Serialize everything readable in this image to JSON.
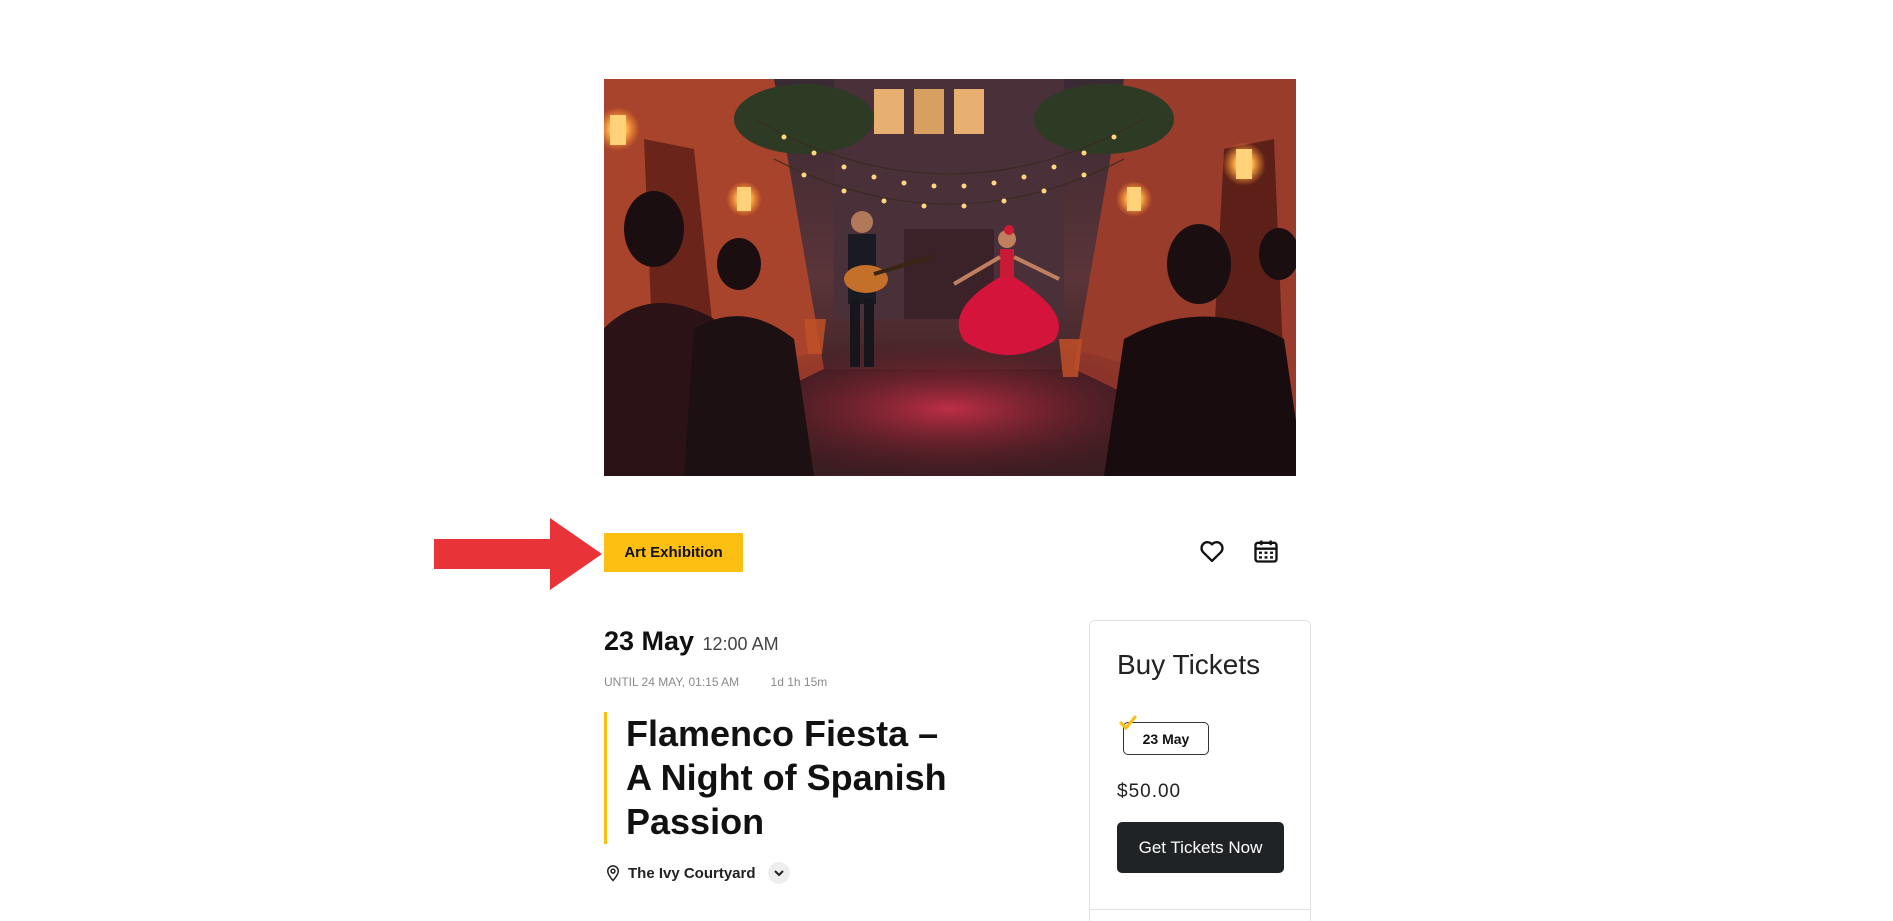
{
  "event": {
    "category": "Art Exhibition",
    "date": "23 May",
    "time": "12:00 AM",
    "until": "UNTIL 24 MAY, 01:15 AM",
    "duration": "1d 1h 15m",
    "title": "Flamenco Fiesta – A Night of Spanish Passion",
    "location": "The Ivy Courtyard"
  },
  "actions": {
    "favorite_icon": "heart-icon",
    "calendar_icon": "calendar-icon"
  },
  "tickets": {
    "heading": "Buy Tickets",
    "selected_date": "23 May",
    "price": "$50.00",
    "button_label": "Get Tickets Now"
  },
  "colors": {
    "accent": "#fdc012",
    "button_dark": "#1f2326",
    "annotation_arrow": "#e83338"
  }
}
